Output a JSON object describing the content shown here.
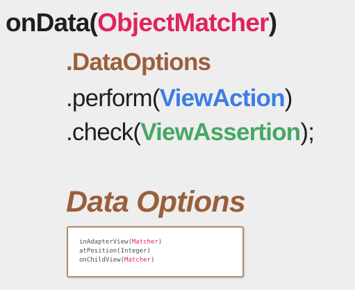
{
  "colors": {
    "background": "#eeeeee",
    "text": "#1f1f1f",
    "object_matcher": "#e0245e",
    "data_options": "#9a5f3b",
    "view_action": "#3d7de1",
    "view_assertion": "#45a864",
    "box_border": "#b08a67",
    "matcher_inline": "#e0245e"
  },
  "code": {
    "line1": {
      "prefix": "onData(",
      "arg": "ObjectMatcher",
      "suffix": ")"
    },
    "line2": {
      "text": ".DataOptions"
    },
    "line3": {
      "prefix": ".perform(",
      "arg": "ViewAction",
      "suffix": ")"
    },
    "line4": {
      "prefix": ".check(",
      "arg": "ViewAssertion",
      "suffix": ");"
    }
  },
  "section": {
    "title": "Data Options"
  },
  "options": [
    {
      "prefix": "inAdapterView(",
      "arg": "Matcher",
      "suffix": ")"
    },
    {
      "prefix": "atPosition(",
      "arg": "Integer",
      "suffix": ")"
    },
    {
      "prefix": "onChildView(",
      "arg": "Matcher",
      "suffix": ")"
    }
  ]
}
